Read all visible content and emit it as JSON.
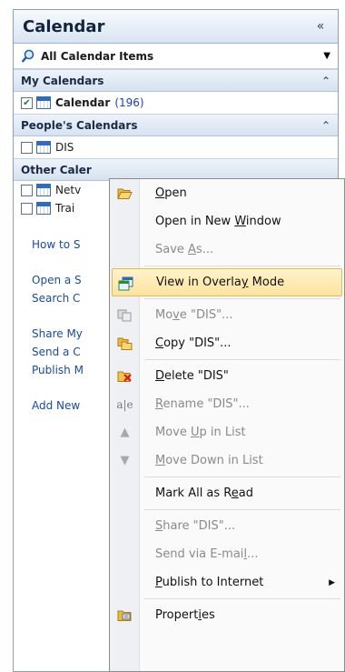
{
  "pane": {
    "title": "Calendar",
    "collapse_glyph": "«",
    "view_selector": {
      "label": "All Calendar Items"
    },
    "groups": [
      {
        "title": "My Calendars",
        "items": [
          {
            "label": "Calendar",
            "checked": true,
            "count": "(196)"
          }
        ]
      },
      {
        "title": "People's Calendars",
        "items": [
          {
            "label": "DIS",
            "checked": false
          }
        ]
      },
      {
        "title": "Other Caler",
        "items": [
          {
            "label": "Netv",
            "checked": false
          },
          {
            "label": "Trai",
            "checked": false
          }
        ]
      }
    ],
    "links": [
      "How to S",
      "Open a S",
      "Search C",
      "Share My",
      "Send a C",
      "Publish M",
      "Add New"
    ]
  },
  "menu": {
    "items": [
      {
        "pre": "",
        "key": "O",
        "post": "pen",
        "disabled": false,
        "icon": "open-folder-icon"
      },
      {
        "pre": "Open in New ",
        "key": "W",
        "post": "indow",
        "disabled": false,
        "icon": ""
      },
      {
        "pre": "Save ",
        "key": "A",
        "post": "s...",
        "disabled": true,
        "icon": ""
      },
      {
        "pre": "View in Overla",
        "key": "y",
        "post": " Mode",
        "disabled": false,
        "icon": "overlay-icon",
        "highlight": true
      },
      {
        "pre": "Mo",
        "key": "v",
        "post": "e \"DIS\"...",
        "disabled": true,
        "icon": "move-icon"
      },
      {
        "pre": "",
        "key": "C",
        "post": "opy \"DIS\"...",
        "disabled": false,
        "icon": "copy-folder-icon"
      },
      {
        "pre": "",
        "key": "D",
        "post": "elete \"DIS\"",
        "disabled": false,
        "icon": "delete-folder-icon"
      },
      {
        "pre": "",
        "key": "R",
        "post": "ename \"DIS\"...",
        "disabled": true,
        "icon": "rename-icon"
      },
      {
        "pre": "Move ",
        "key": "U",
        "post": "p in List",
        "disabled": true,
        "icon": "up-arrow-icon"
      },
      {
        "pre": "",
        "key": "M",
        "post": "ove Down in List",
        "disabled": true,
        "icon": "down-arrow-icon"
      },
      {
        "pre": "Mark All as R",
        "key": "e",
        "post": "ad",
        "disabled": false,
        "icon": ""
      },
      {
        "pre": "",
        "key": "S",
        "post": "hare \"DIS\"...",
        "disabled": true,
        "icon": ""
      },
      {
        "pre": "Send via E-mai",
        "key": "l",
        "post": "...",
        "disabled": true,
        "icon": ""
      },
      {
        "pre": "",
        "key": "P",
        "post": "ublish to Internet",
        "disabled": false,
        "icon": "",
        "submenu": true
      },
      {
        "pre": "Propert",
        "key": "i",
        "post": "es",
        "disabled": false,
        "icon": "properties-icon"
      }
    ]
  }
}
